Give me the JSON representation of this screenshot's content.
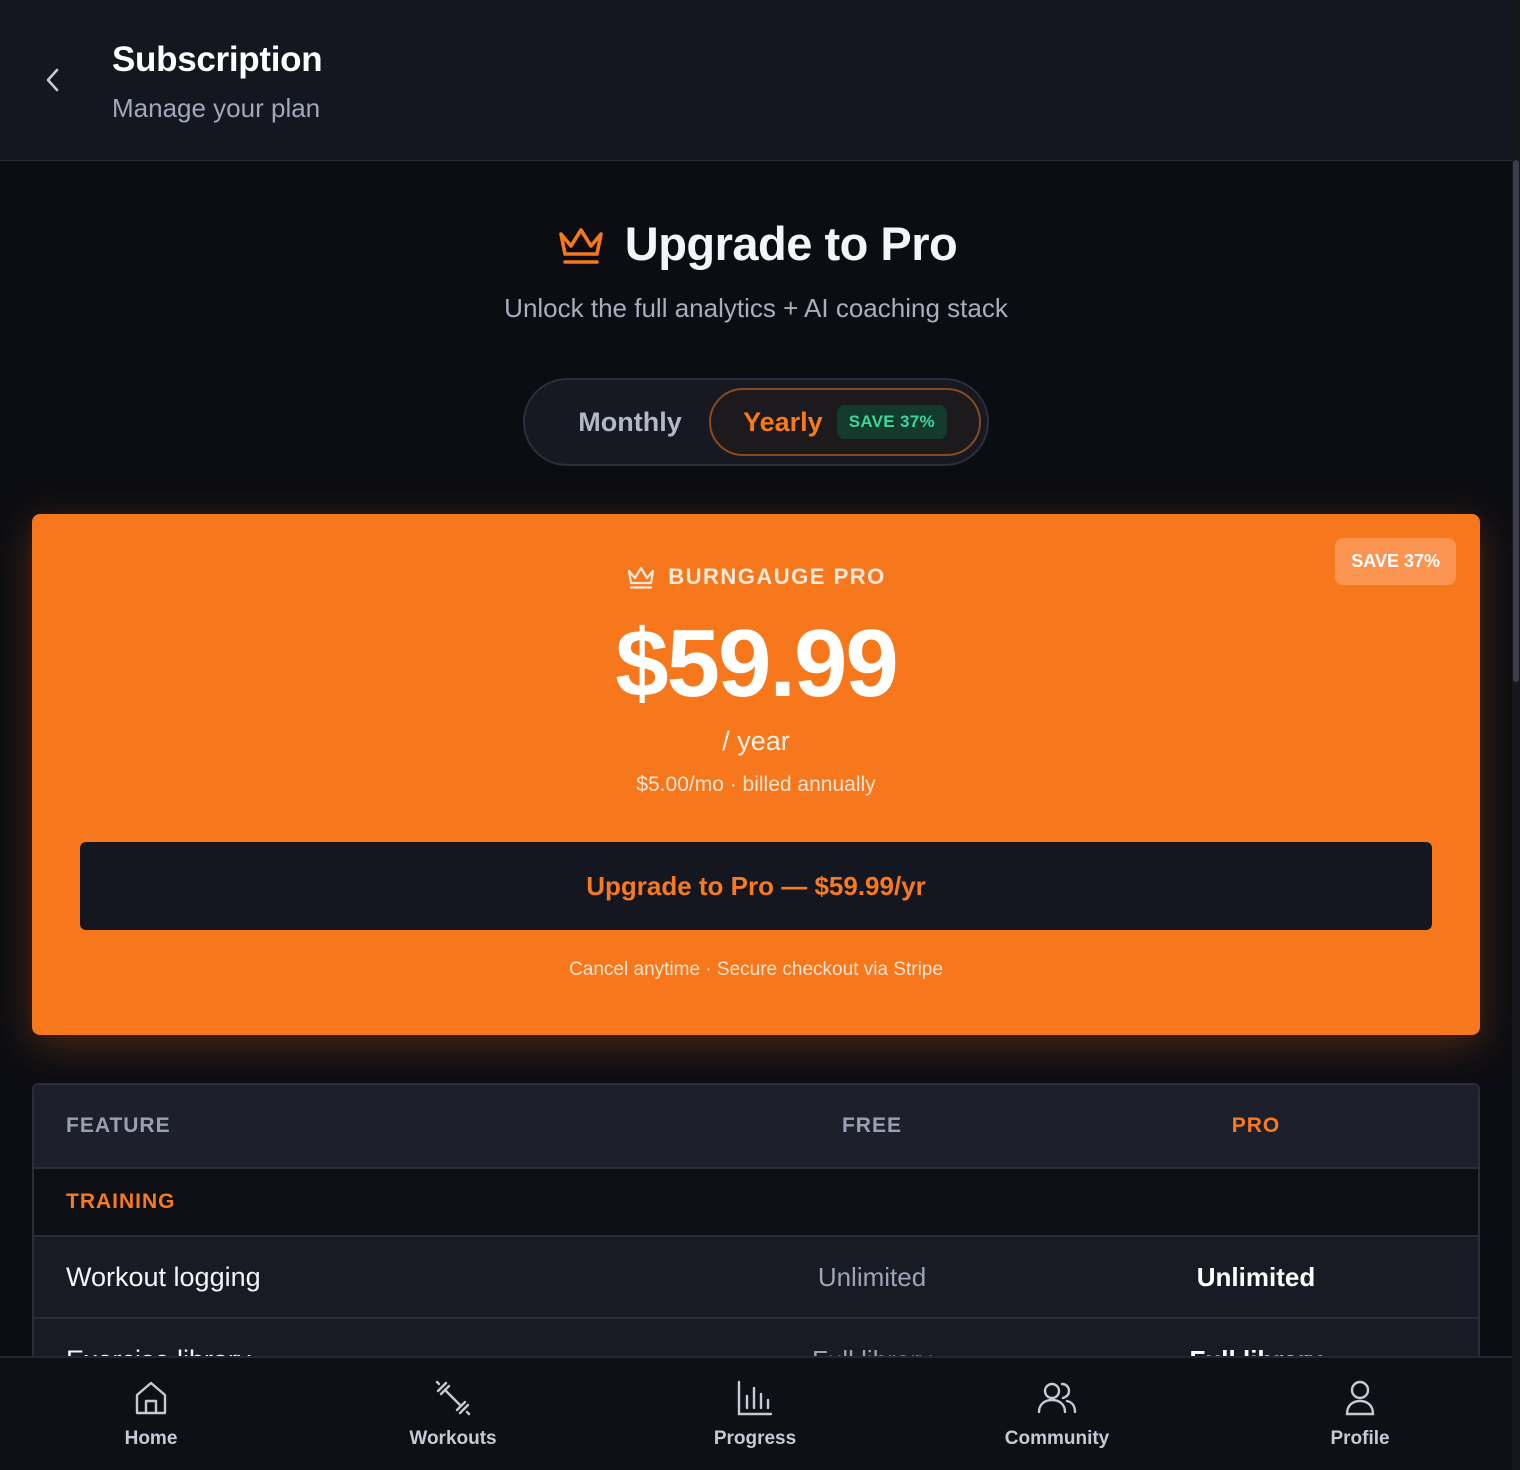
{
  "header": {
    "title": "Subscription",
    "subtitle": "Manage your plan"
  },
  "hero": {
    "title": "Upgrade to Pro",
    "subtitle": "Unlock the full analytics + AI coaching stack"
  },
  "billing_toggle": {
    "monthly_label": "Monthly",
    "yearly_label": "Yearly",
    "yearly_badge": "SAVE 37%",
    "selected": "Yearly"
  },
  "plan": {
    "badge": "SAVE 37%",
    "name": "BURNGAUGE PRO",
    "price": "$59.99",
    "period": "/ year",
    "monthly_equivalent": "$5.00/mo · billed annually",
    "cta_label": "Upgrade to Pro — $59.99/yr",
    "footnote": "Cancel anytime · Secure checkout via Stripe"
  },
  "comparison": {
    "headers": {
      "feature": "FEATURE",
      "free": "FREE",
      "pro": "PRO"
    },
    "section": "TRAINING",
    "rows": [
      {
        "feature": "Workout logging",
        "free": "Unlimited",
        "pro": "Unlimited"
      },
      {
        "feature": "Exercise library",
        "free": "Full library",
        "pro": "Full library"
      }
    ]
  },
  "tabbar": {
    "items": [
      {
        "label": "Home",
        "icon": "home-icon"
      },
      {
        "label": "Workouts",
        "icon": "dumbbell-icon"
      },
      {
        "label": "Progress",
        "icon": "bar-chart-icon"
      },
      {
        "label": "Community",
        "icon": "users-icon"
      },
      {
        "label": "Profile",
        "icon": "user-icon"
      }
    ]
  },
  "colors": {
    "accent": "#f7771c",
    "background": "#0c0d12",
    "surface": "#141620",
    "success": "#3fd49b"
  }
}
